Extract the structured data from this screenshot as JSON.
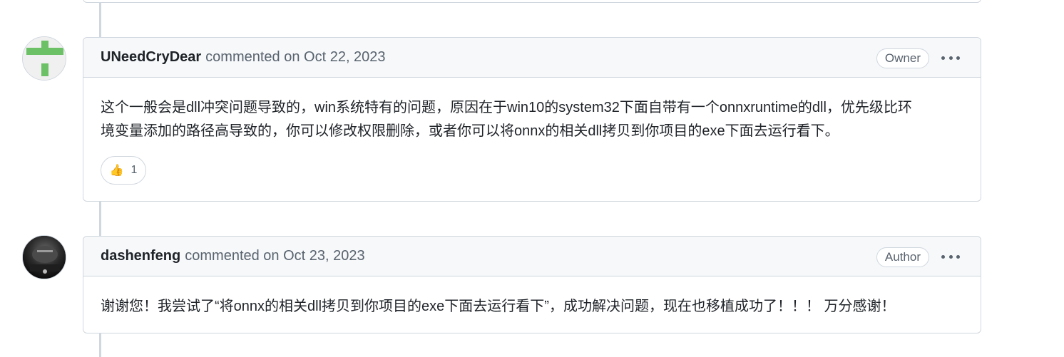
{
  "comments": [
    {
      "author": "UNeedCryDear",
      "meta": "commented on Oct 22, 2023",
      "role": "Owner",
      "body_line1": "这个一般会是dll冲突问题导致的，win系统特有的问题，原因在于win10的system32下面自带有一个onnxruntime的dll，优先级比环",
      "body_line2": "境变量添加的路径高导致的，你可以修改权限删除，或者你可以将onnx的相关dll拷贝到你项目的exe下面去运行看下。",
      "reaction": {
        "emoji": "👍",
        "count": "1"
      }
    },
    {
      "author": "dashenfeng",
      "meta": "commented on Oct 23, 2023",
      "role": "Author",
      "body_line1": "谢谢您！我尝试了“将onnx的相关dll拷贝到你项目的exe下面去运行看下”，成功解决问题，现在也移植成功了！！！ 万分感谢！"
    }
  ],
  "icons": {
    "more": "kebab-horizontal-icon",
    "reaction": "thumbs-up-icon"
  },
  "colors": {
    "identicon_green": "#6cc066",
    "border": "#d0d7de",
    "header_bg": "#f6f8fa",
    "muted_text": "#59636e"
  }
}
